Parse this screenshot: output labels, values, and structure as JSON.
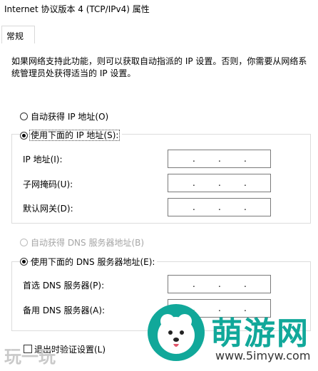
{
  "window": {
    "title": "Internet 协议版本 4 (TCP/IPv4) 属性"
  },
  "tabs": [
    {
      "label": "常规"
    }
  ],
  "general": {
    "description": "如果网络支持此功能，则可以获取自动指派的 IP 设置。否则，你需要从网络系统管理员处获得适当的 IP 设置。",
    "ip_mode": {
      "auto_label": "自动获得 IP 地址(O)",
      "manual_label": "使用下面的 IP 地址(S):",
      "selected": "manual"
    },
    "ip_fields": [
      {
        "label": "IP 地址(I):",
        "value": ". . ."
      },
      {
        "label": "子网掩码(U):",
        "value": ". . ."
      },
      {
        "label": "默认网关(D):",
        "value": ". . ."
      }
    ],
    "dns_mode": {
      "auto_label": "自动获得 DNS 服务器地址(B)",
      "manual_label": "使用下面的 DNS 服务器地址(E):",
      "selected": "manual",
      "auto_disabled": true
    },
    "dns_fields": [
      {
        "label": "首选 DNS 服务器(P):",
        "value": ". . ."
      },
      {
        "label": "备用 DNS 服务器(A):",
        "value": ". . ."
      }
    ],
    "validate_on_exit": {
      "label": "退出时验证设置(L)",
      "checked": false
    }
  },
  "watermark": {
    "brand": "萌游网",
    "url": "www.5imyw.com",
    "left_text": "玩一玩"
  },
  "colors": {
    "brand_teal": "#11a89a",
    "border": "#7a7a7a"
  }
}
